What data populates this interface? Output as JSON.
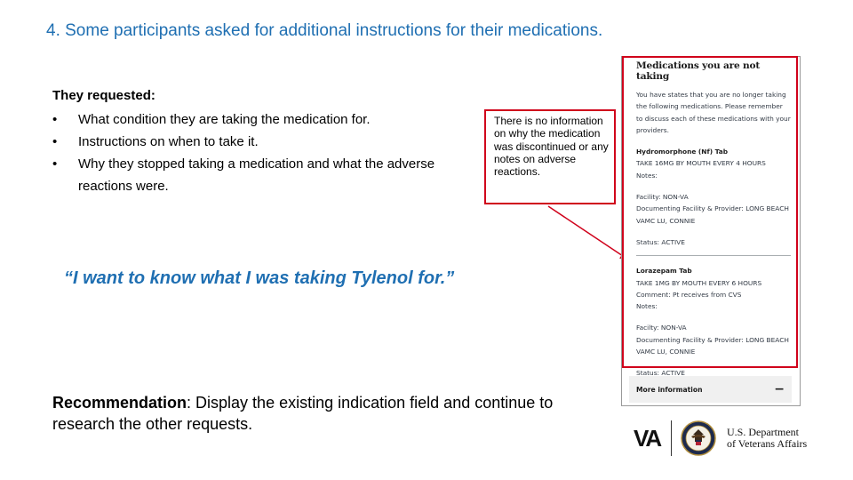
{
  "slide": {
    "title": "4. Some participants asked for additional instructions for their medications.",
    "requested_heading": "They requested:",
    "requests": [
      "What condition they are taking the medication for.",
      "Instructions  on when to take it.",
      "Why they stopped taking a medication and what the adverse reactions were."
    ],
    "quote": "“I want to know what I was taking Tylenol for.”",
    "recommendation_label": "Recommendation",
    "recommendation_text": ": Display the existing indication field and continue to research the other requests.",
    "callout": "There is no information on why the medication was discontinued or any notes on adverse reactions."
  },
  "screenshot": {
    "heading": "Medications you are not taking",
    "intro": "You have states that you are no longer taking the following medications. Please remember to discuss each of these medications with your providers.",
    "meds": [
      {
        "name": "Hydromorphone (Nf) Tab",
        "instructions": "TAKE 16MG BY MOUTH EVERY 4 HOURS",
        "comment": "",
        "notes": "Notes:",
        "facility": "Facility: NON-VA",
        "provider": "Documenting Facility & Provider: LONG BEACH VAMC LU, CONNIE",
        "status": "Status: ACTIVE"
      },
      {
        "name": "Lorazepam Tab",
        "instructions": "TAKE 1MG BY MOUTH EVERY 6 HOURS",
        "comment": "Comment: Pt receives from CVS",
        "notes": "Notes:",
        "facility": "Facilty: NON-VA",
        "provider": "Documenting Facility & Provider: LONG BEACH VAMC LU, CONNIE",
        "status": "Status: ACTIVE"
      }
    ],
    "more_info_label": "More information",
    "more_info_toggle": "−"
  },
  "footer": {
    "va_mark": "VA",
    "dept_line1": "U.S. Department",
    "dept_line2": "of Veterans Affairs"
  },
  "colors": {
    "accent_blue": "#1f6fb2",
    "highlight_red": "#d0021b"
  }
}
